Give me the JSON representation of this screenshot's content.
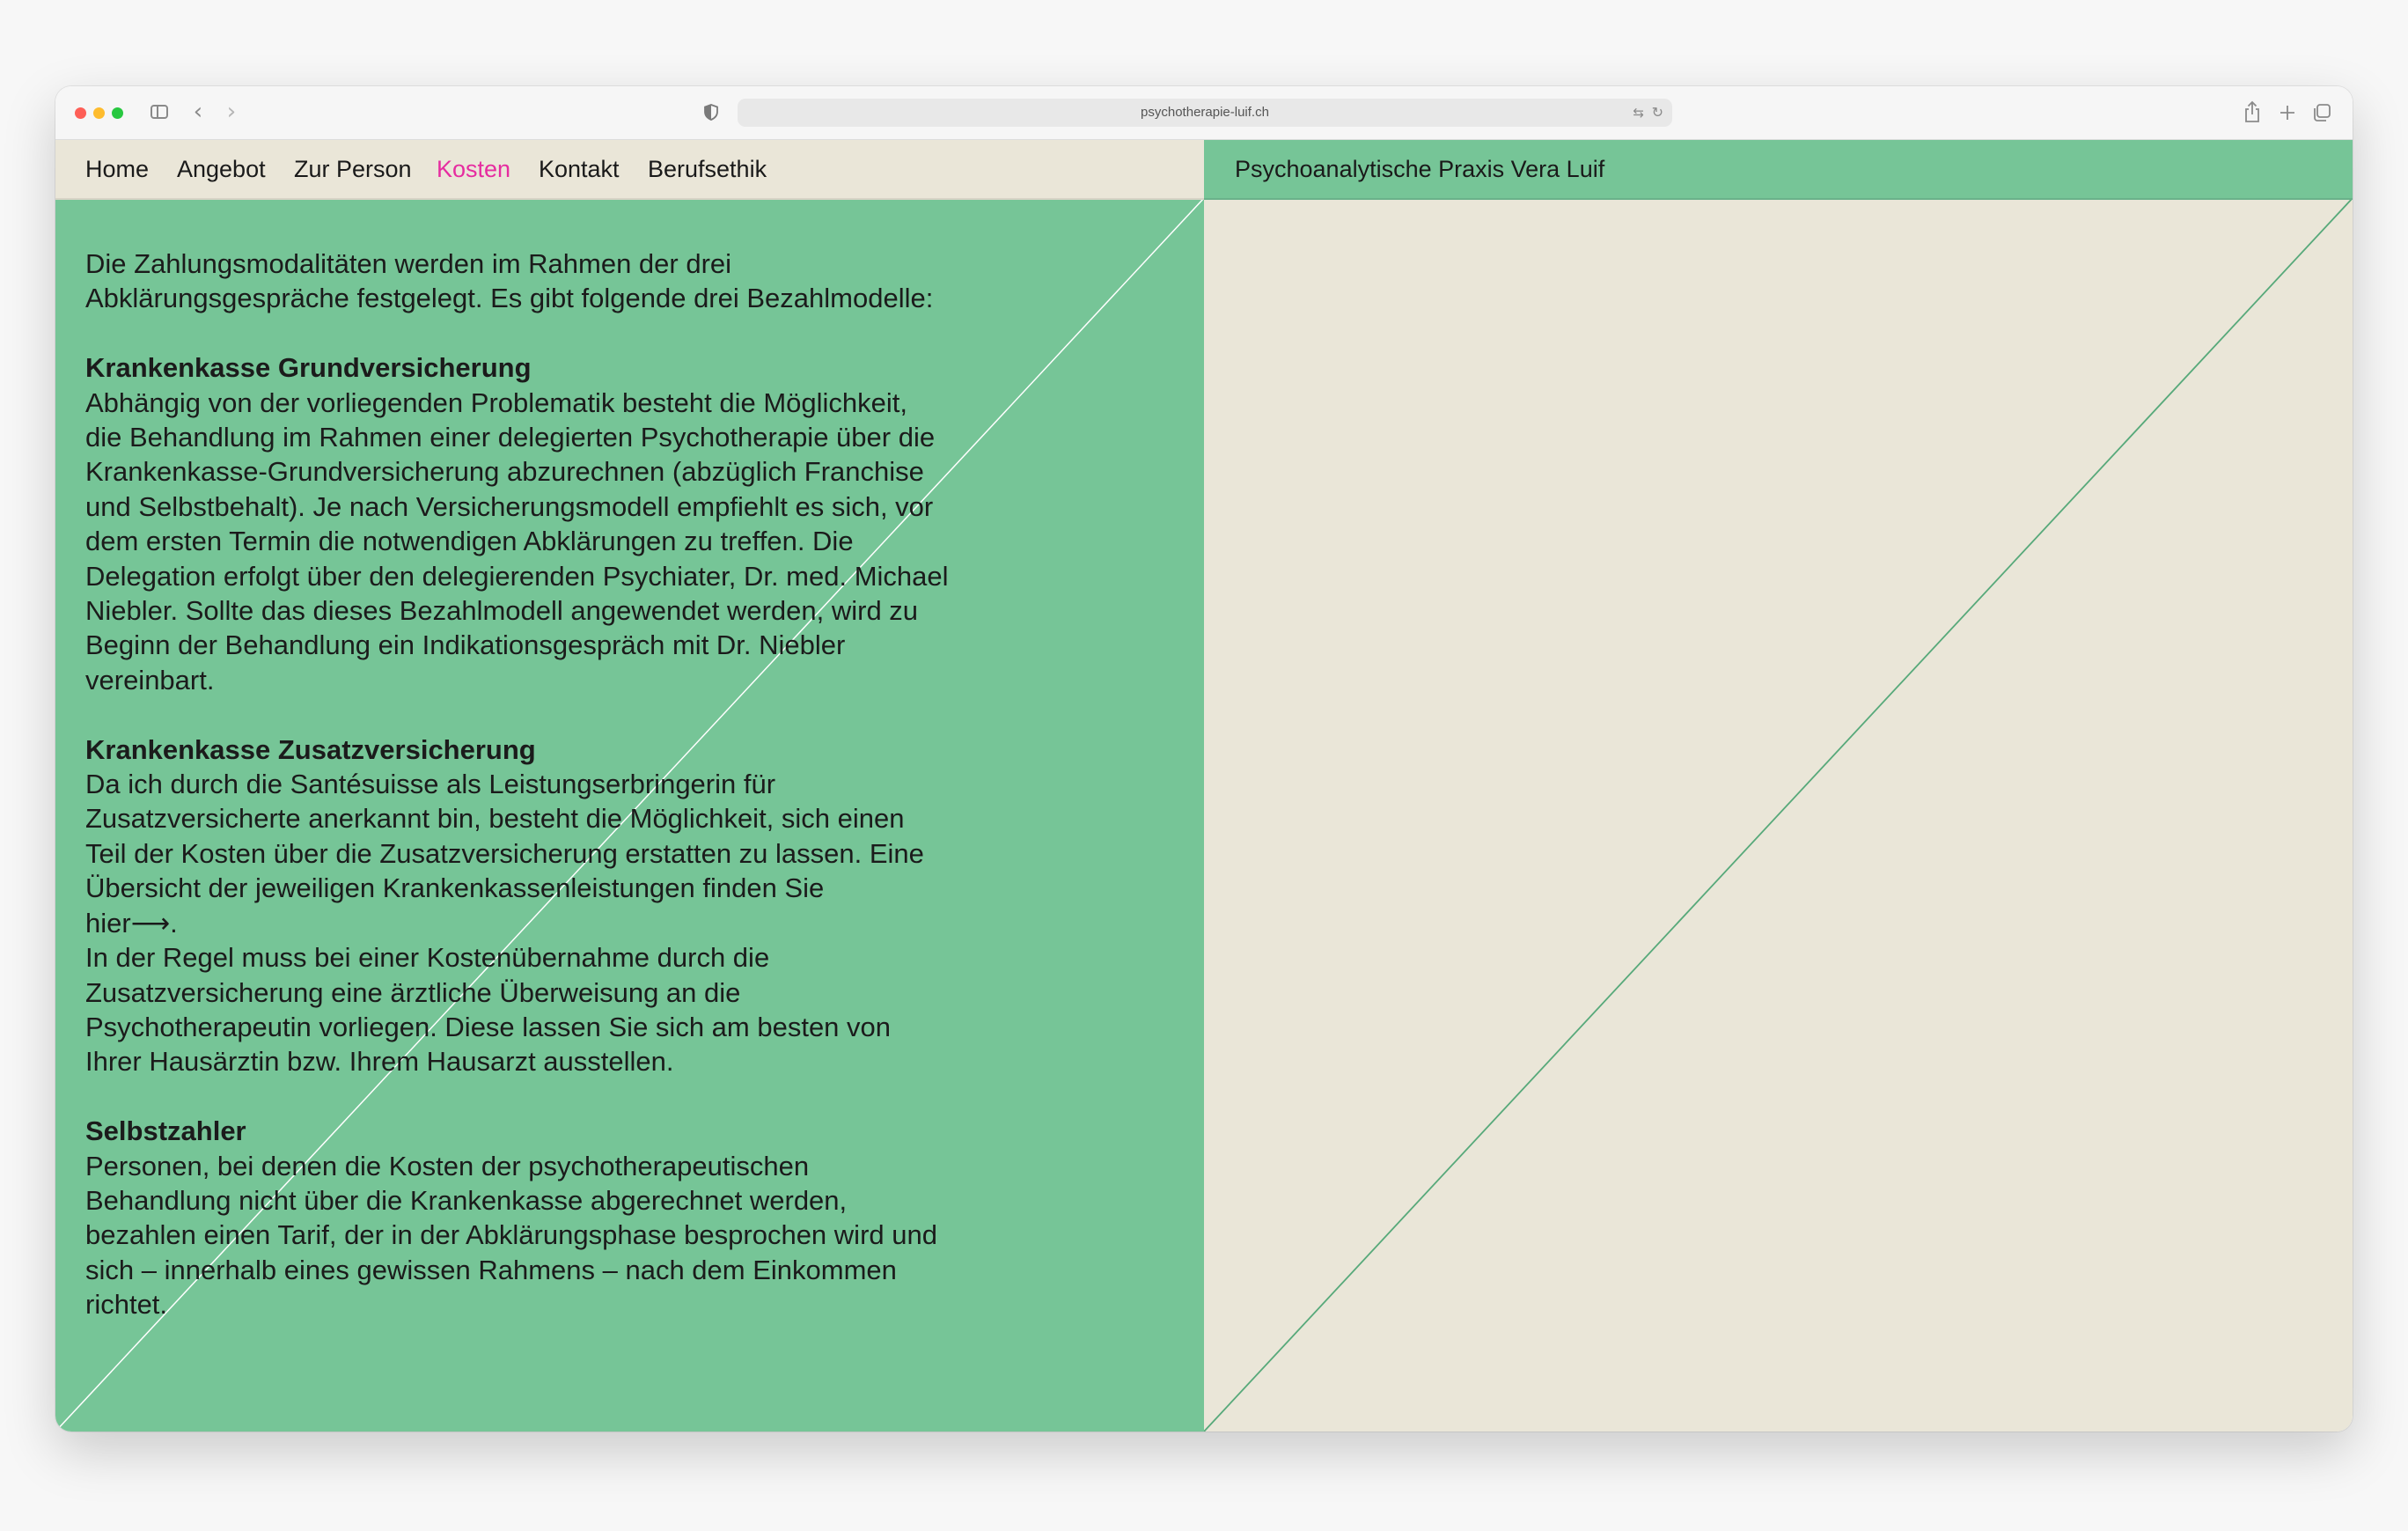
{
  "browser": {
    "url": "psychotherapie-luif.ch",
    "icons": {
      "sidebar": "sidebar-icon",
      "back": "chevron-left-icon",
      "forward": "chevron-right-icon",
      "privacy": "shield-icon",
      "translate": "translate-icon",
      "reload": "reload-icon",
      "share": "share-icon",
      "new_tab": "plus-icon",
      "tabs": "tab-overview-icon"
    }
  },
  "nav": {
    "items": [
      {
        "label": "Home"
      },
      {
        "label": "Angebot"
      },
      {
        "label": "Zur Person"
      },
      {
        "label": "Kosten",
        "active": true
      },
      {
        "label": "Kontakt"
      },
      {
        "label": "Berufsethik"
      }
    ]
  },
  "site": {
    "title": "Psychoanalytische Praxis Vera Luif"
  },
  "colors": {
    "green": "#76c597",
    "beige": "#eae6d8",
    "active_nav": "#e62ca0",
    "text": "#1b1b1b"
  },
  "content": {
    "intro": [
      "Die Zahlungsmodalitäten werden im Rahmen der drei",
      "Abklärungsgespräche festgelegt. Es gibt folgende drei Bezahlmodelle:"
    ],
    "sections": [
      {
        "heading": "Krankenkasse Grundversicherung",
        "lines": [
          "Abhängig von der vorliegenden Problematik besteht die Möglichkeit,",
          "die Behandlung im Rahmen einer delegierten Psychotherapie über die",
          "Krankenkasse-Grundversicherung abzurechnen (abzüglich Franchise",
          "und Selbstbehalt). Je nach Versicherungsmodell empfiehlt es sich, vor",
          "dem ersten Termin die notwendigen Abklärungen zu treffen. Die",
          "Delegation erfolgt über den delegierenden Psychiater, Dr. med. Michael",
          "Niebler. Sollte das dieses Bezahlmodell angewendet werden, wird zu",
          "Beginn der Behandlung ein Indikationsgespräch mit Dr. Niebler",
          "vereinbart."
        ]
      },
      {
        "heading": "Krankenkasse Zusatzversicherung",
        "lines": [
          "Da ich durch die Santésuisse als Leistungserbringerin für",
          "Zusatzversicherte anerkannt bin, besteht die Möglichkeit, sich einen",
          "Teil der Kosten über die Zusatzversicherung erstatten zu lassen. Eine",
          "Übersicht der jeweiligen Krankenkassenleistungen finden Sie"
        ],
        "link": "hier⟶.",
        "lines_after": [
          "In der Regel muss bei einer Kostenübernahme durch die",
          "Zusatzversicherung eine ärztliche Überweisung an die",
          "Psychotherapeutin vorliegen. Diese lassen Sie sich am besten von",
          "Ihrer Hausärztin bzw. Ihrem Hausarzt ausstellen."
        ]
      },
      {
        "heading": "Selbstzahler",
        "lines": [
          "Personen, bei denen die Kosten der psychotherapeutischen",
          "Behandlung nicht über die Krankenkasse abgerechnet werden,",
          "bezahlen einen Tarif, der in der Abklärungsphase besprochen wird und",
          "sich – innerhalb eines gewissen Rahmens – nach dem Einkommen",
          "richtet."
        ]
      }
    ]
  }
}
